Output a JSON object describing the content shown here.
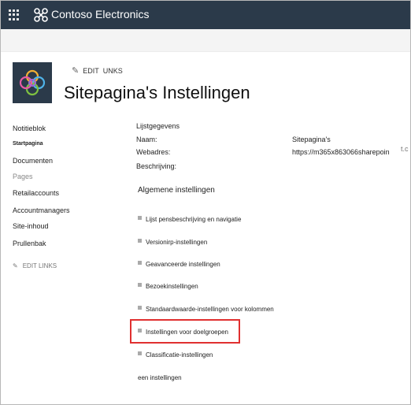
{
  "suitebar": {
    "brand_name": "Contoso Electronics",
    "background": "#2b3a4a",
    "app_launcher_icon": "waffle-icon",
    "brand_icon": "contoso-logo-icon"
  },
  "header": {
    "edit_label": "EDIT",
    "links_label": "UNKS",
    "title": "Sitepagina's  Instellingen"
  },
  "leftnav": {
    "items": [
      {
        "label": "Notitieblok"
      },
      {
        "label": "Startpagina"
      },
      {
        "label": "Documenten"
      },
      {
        "label": "Pages"
      },
      {
        "label": "Retailaccounts"
      },
      {
        "label": "Accountmanagers"
      },
      {
        "label": "Site-inhoud"
      },
      {
        "label": "Prullenbak"
      }
    ],
    "edit_links_label": "EDIT LINKS"
  },
  "list_info": {
    "heading": "Lijstgegevens",
    "name_label": "Naam:",
    "name_value": "Sitepagina's",
    "url_label": "Webadres:",
    "url_value": "https://m365x863066sharepoin",
    "url_clipped": "t.c",
    "description_label": "Beschrijving:"
  },
  "general_settings": {
    "heading": "Algemene instellingen",
    "links": [
      {
        "label": "Lijst pensbeschrijving en navigatie"
      },
      {
        "label": "Versionirp-instellingen"
      },
      {
        "label": "Geavanceerde instellingen"
      },
      {
        "label": "Bezoekinstellingen"
      },
      {
        "label": "Standaardwaarde-instellingen voor kolommen"
      },
      {
        "label": "Instellingen voor doelgroepen"
      },
      {
        "label": "Classificatie-instellingen"
      }
    ],
    "trailing": "een instellingen",
    "highlight_color": "#e03030"
  }
}
